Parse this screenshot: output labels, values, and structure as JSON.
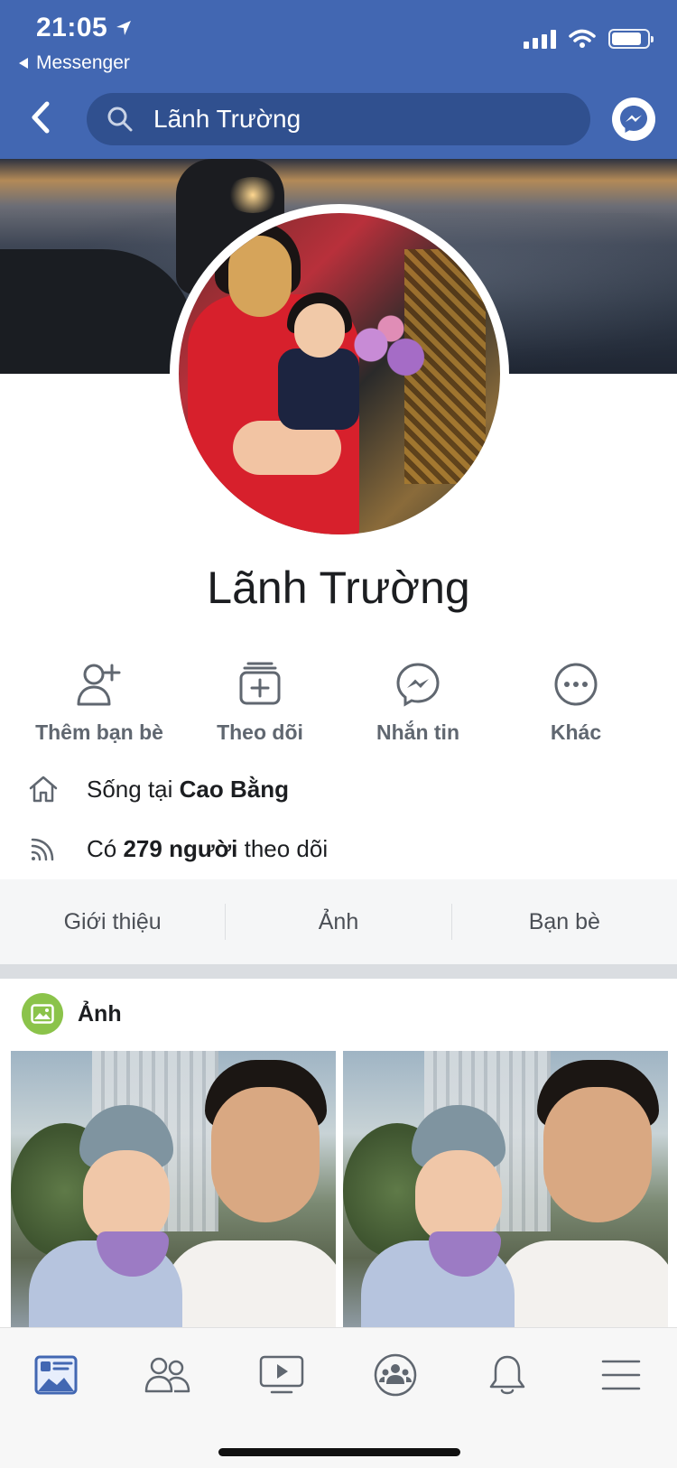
{
  "status_bar": {
    "time": "21:05",
    "back_app": "Messenger"
  },
  "header": {
    "search_text": "Lãnh Trường"
  },
  "profile": {
    "name": "Lãnh Trường"
  },
  "actions": [
    {
      "label": "Thêm bạn bè",
      "icon": "add-friend-icon"
    },
    {
      "label": "Theo dõi",
      "icon": "follow-icon"
    },
    {
      "label": "Nhắn tin",
      "icon": "messenger-icon"
    },
    {
      "label": "Khác",
      "icon": "more-icon"
    }
  ],
  "info": {
    "lives_prefix": "Sống tại ",
    "lives_place": "Cao Bằng",
    "followers_prefix": "Có ",
    "followers_count": "279 người",
    "followers_suffix": " theo dõi"
  },
  "tabs": [
    {
      "label": "Giới thiệu"
    },
    {
      "label": "Ảnh"
    },
    {
      "label": "Bạn bè"
    }
  ],
  "photos_section": {
    "title": "Ảnh"
  },
  "bottom_nav": [
    {
      "icon": "news-feed-icon",
      "active": true
    },
    {
      "icon": "friends-icon",
      "active": false
    },
    {
      "icon": "watch-icon",
      "active": false
    },
    {
      "icon": "groups-icon",
      "active": false
    },
    {
      "icon": "notifications-icon",
      "active": false
    },
    {
      "icon": "menu-icon",
      "active": false
    }
  ],
  "colors": {
    "brand_blue": "#4267b2",
    "search_bg": "#30508f",
    "photos_green": "#8bc34a"
  }
}
